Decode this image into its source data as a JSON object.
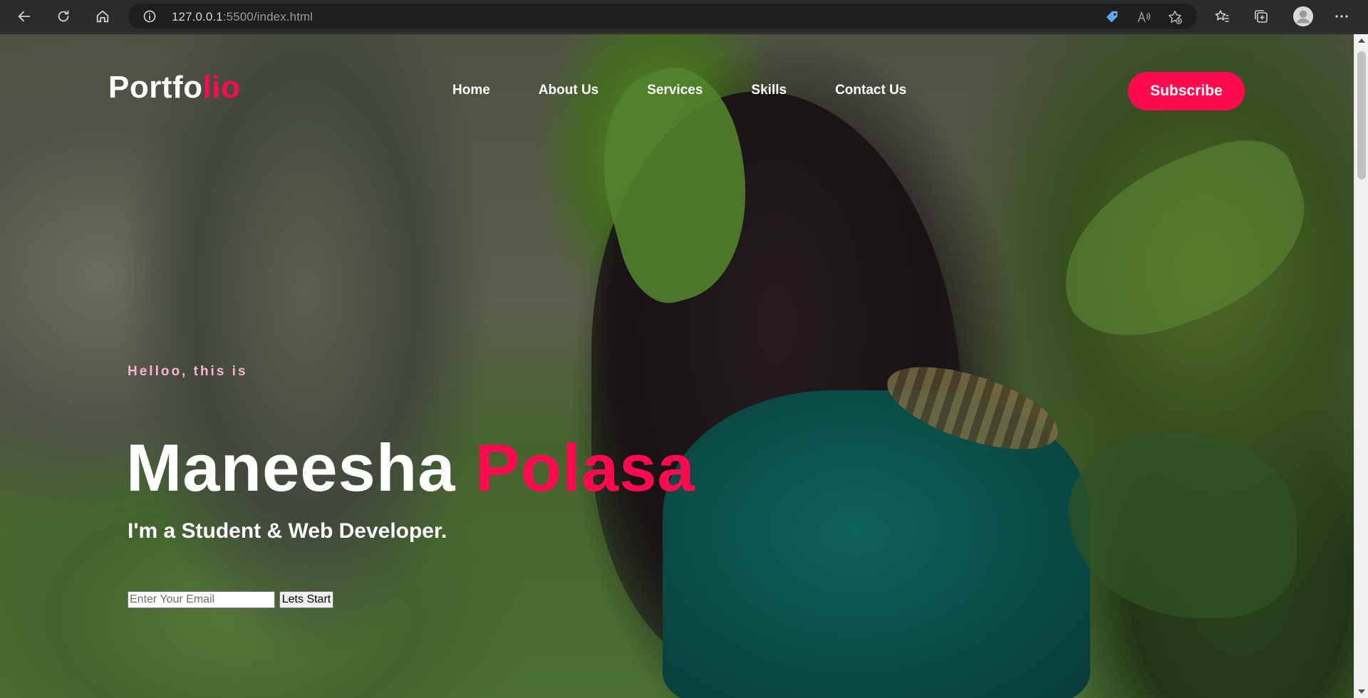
{
  "browser": {
    "url_host": "127.0.0.1",
    "url_path": ":5500/index.html",
    "icons": [
      "back-icon",
      "refresh-icon",
      "home-icon",
      "info-icon",
      "tag-icon",
      "read-aloud-icon",
      "add-favorite-icon",
      "favorites-icon",
      "collections-icon",
      "profile-icon",
      "more-icon"
    ]
  },
  "site": {
    "logo_main": "Portfo",
    "logo_accent": "lio",
    "nav": [
      "Home",
      "About Us",
      "Services",
      "Skills",
      "Contact Us"
    ],
    "subscribe_label": "Subscribe",
    "accent_color": "#ff0a4f"
  },
  "hero": {
    "greeting": "Helloo, this is",
    "first_name": "Maneesha ",
    "last_name": "Polasa",
    "tagline": "I'm a Student & Web Developer.",
    "email_placeholder": "Enter Your Email",
    "start_label": "Lets Start"
  }
}
